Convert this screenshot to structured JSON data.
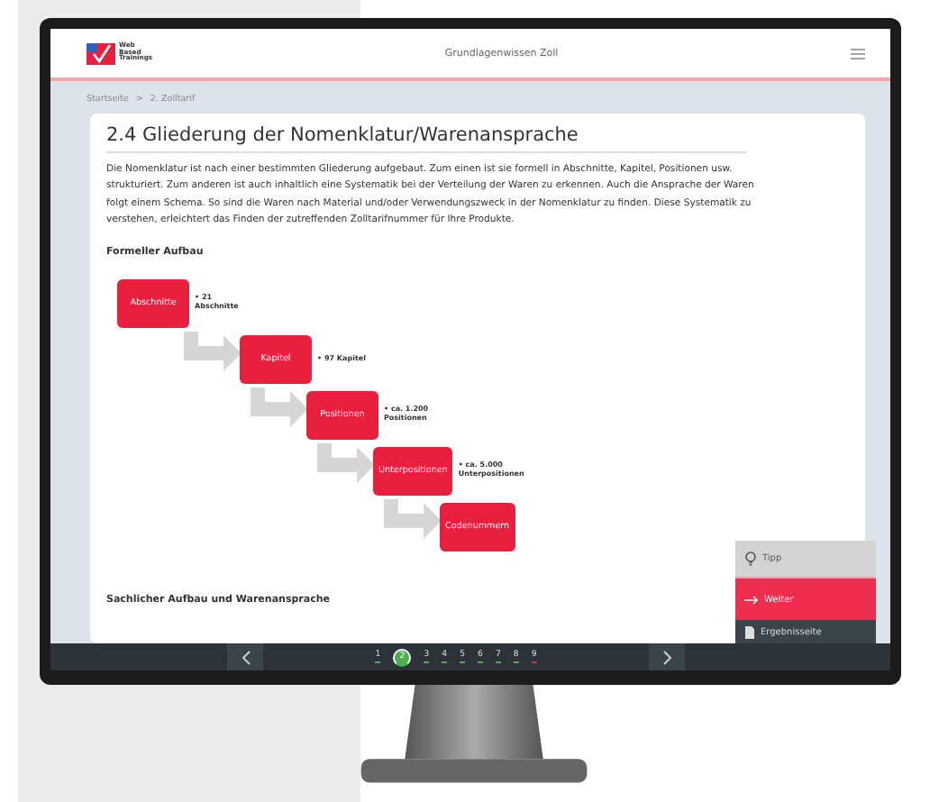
{
  "header": {
    "logo_lines": [
      "Web",
      "Based",
      "Trainings"
    ],
    "title": "Grundlagenwissen Zoll"
  },
  "breadcrumb": [
    {
      "label": "Startseite"
    },
    {
      "label": "2. Zolltarif"
    }
  ],
  "breadcrumb_separator": ">",
  "heading": "2.4 Gliederung der Nomenklatur/Warenansprache",
  "paragraph": "Die Nomenklatur ist nach einer bestimmten Gliederung aufgebaut. Zum einen ist sie formell in Abschnitte, Kapitel, Positionen usw. strukturiert. Zum anderen ist auch inhaltlich eine Systematik bei der Verteilung der Waren zu erkennen. Auch die Ansprache der Waren folgt einem Schema. So sind die Waren nach Material und/oder Verwendungszweck in der Nomenklatur zu finden. Diese Systematik zu verstehen, erleichtert das Finden der zutreffenden Zolltarifnummer für Ihre Produkte.",
  "section_1": "Formeller Aufbau",
  "steps": [
    {
      "label": "Abschnitte",
      "note": "• 21 Abschnitte"
    },
    {
      "label": "Kapitel",
      "note": "• 97 Kapitel"
    },
    {
      "label": "Positionen",
      "note": "• ca. 1.200 Positionen"
    },
    {
      "label": "Unterpositionen",
      "note": "• ca. 5.000 Unterpositionen"
    },
    {
      "label": "Codenummern"
    }
  ],
  "section_2": "Sachlicher Aufbau und Warenansprache",
  "side_buttons": [
    {
      "kind": "tip",
      "label": "Tipp"
    },
    {
      "kind": "next",
      "label": "Weiter"
    },
    {
      "kind": "results",
      "label": "Ergebnisseite"
    }
  ],
  "pager": [
    {
      "label": "1",
      "selected": false,
      "color": "#4caf50"
    },
    {
      "label": "2",
      "selected": true,
      "color": "#4caf50"
    },
    {
      "label": "3",
      "selected": false,
      "color": "#4caf50"
    },
    {
      "label": "4",
      "selected": false,
      "color": "#4caf50"
    },
    {
      "label": "5",
      "selected": false,
      "color": "#4caf50"
    },
    {
      "label": "6",
      "selected": false,
      "color": "#4caf50"
    },
    {
      "label": "7",
      "selected": false,
      "color": "#4caf50"
    },
    {
      "label": "8",
      "selected": false,
      "color": "#4caf50"
    },
    {
      "label": "9",
      "selected": false,
      "color": "#e8203e"
    }
  ]
}
